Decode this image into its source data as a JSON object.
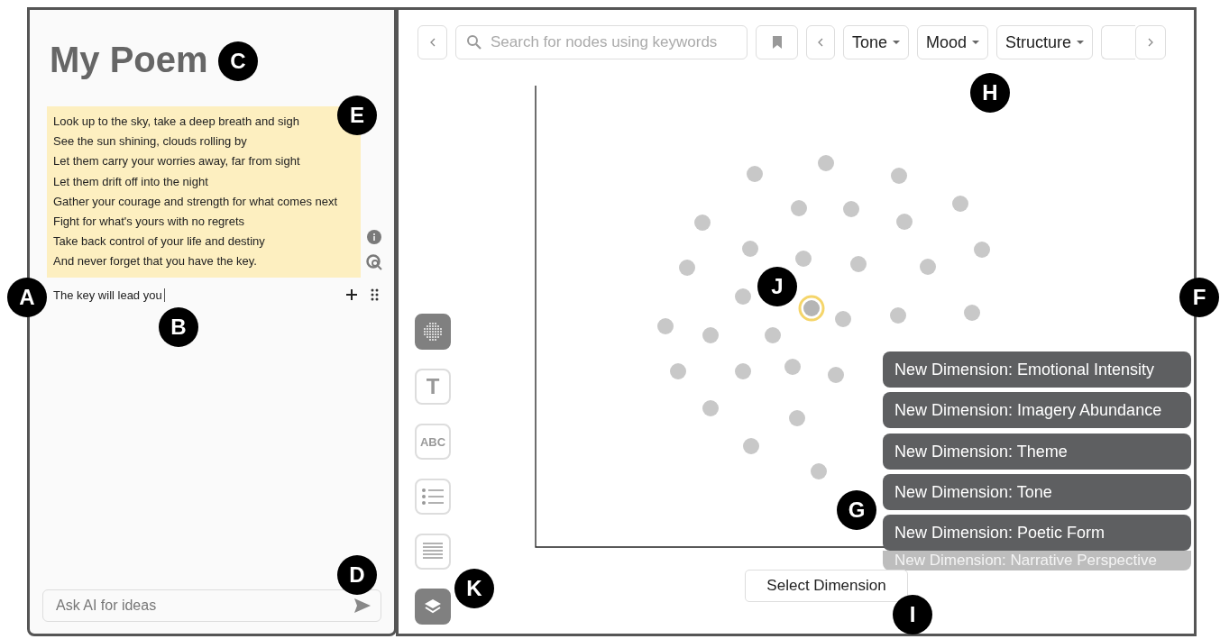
{
  "editor": {
    "title": "My Poem",
    "poem": {
      "highlighted": true,
      "lines": [
        "Look up to the sky, take a deep breath and sigh",
        "See the sun shining, clouds rolling by",
        "Let them carry your worries away, far from sight",
        "Let them drift off into the night",
        "Gather your courage and strength for what comes next",
        "Fight for what's yours with no regrets",
        "Take back control of your life and destiny",
        "And never forget that you have the key."
      ]
    },
    "current_line": "The key will lead you",
    "chat": {
      "placeholder": "Ask AI for ideas"
    }
  },
  "explorer": {
    "search": {
      "placeholder": "Search for nodes using keywords"
    },
    "filters": [
      {
        "label": "Tone"
      },
      {
        "label": "Mood"
      },
      {
        "label": "Structure"
      }
    ],
    "tools": [
      {
        "kind": "scatter",
        "selected": true
      },
      {
        "kind": "text",
        "label": "T",
        "selected": false
      },
      {
        "kind": "text",
        "label": "ABC",
        "selected": false
      },
      {
        "kind": "list",
        "selected": false
      },
      {
        "kind": "lines",
        "selected": false
      },
      {
        "kind": "layers",
        "selected": true
      }
    ],
    "dimension_menu": [
      {
        "label": "New Dimension: Emotional Intensity",
        "faded": false
      },
      {
        "label": "New Dimension: Imagery Abundance",
        "faded": false
      },
      {
        "label": "New Dimension: Theme",
        "faded": false
      },
      {
        "label": "New Dimension: Tone",
        "faded": false
      },
      {
        "label": "New Dimension: Poetic Form",
        "faded": false
      },
      {
        "label": "New Dimension: Narrative Perspective",
        "faded": true
      }
    ],
    "select_button": "Select Dimension"
  },
  "callouts": [
    {
      "label": "A"
    },
    {
      "label": "B"
    },
    {
      "label": "C"
    },
    {
      "label": "D"
    },
    {
      "label": "E"
    },
    {
      "label": "F"
    },
    {
      "label": "G"
    },
    {
      "label": "H"
    },
    {
      "label": "I"
    },
    {
      "label": "J"
    },
    {
      "label": "K"
    }
  ]
}
